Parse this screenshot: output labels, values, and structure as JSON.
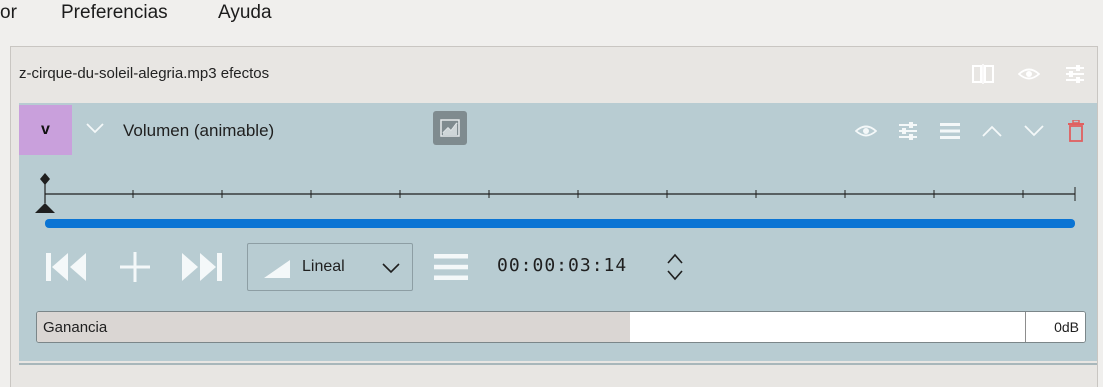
{
  "menubar": {
    "items": [
      {
        "label": "or"
      },
      {
        "label": "Preferencias"
      },
      {
        "label": "Ayuda"
      }
    ]
  },
  "panel": {
    "title": "z-cirque-du-soleil-alegria.mp3 efectos",
    "title_icons": [
      "compare-split-icon",
      "eye-icon",
      "sliders-icon"
    ]
  },
  "effect": {
    "badge": "v",
    "badge_color": "#c9a0dc",
    "name": "Volumen (animable)",
    "actions": [
      "eye-icon",
      "sliders-icon",
      "menu-icon",
      "chevron-up-icon",
      "chevron-down-icon",
      "trash-icon"
    ],
    "timeline_progress_color": "#0a74d4",
    "keyframes": {
      "interpolation": "Lineal",
      "timecode": "00:00:03:14"
    },
    "gain": {
      "label": "Ganancia",
      "value": "0dB",
      "fill_fraction": 0.6
    }
  },
  "colors": {
    "effect_bg": "#b8ccd2",
    "accent": "#0a74d4",
    "delete": "#e06060"
  }
}
